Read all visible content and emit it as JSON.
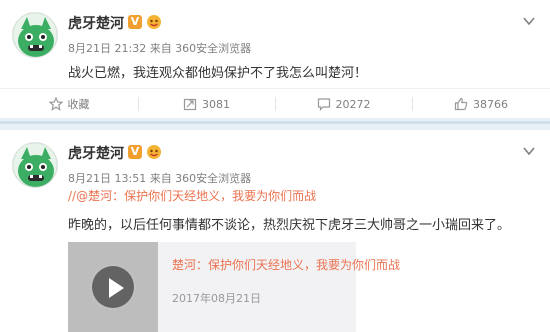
{
  "posts": [
    {
      "author": "虎牙楚河",
      "verified_mark": "V",
      "meta": "8月21日 21:32 来自 360安全浏览器",
      "text": "战火已燃，我连观众都他妈保护不了我怎么叫楚河！",
      "actions": {
        "favorite": "收藏",
        "repost": "3081",
        "comment": "20272",
        "like": "38766"
      }
    },
    {
      "author": "虎牙楚河",
      "verified_mark": "V",
      "meta": "8月21日 13:51 来自 360安全浏览器",
      "repost_line": "//@楚河：保护你们天经地义，我要为你们而战",
      "text": "昨晚的，以后任何事情都不谈论，热烈庆祝下虎牙三大帅哥之一小瑞回来了。",
      "card": {
        "title": "楚河：保护你们天经地义，我要为你们而战",
        "date": "2017年08月21日"
      }
    }
  ],
  "colors": {
    "accent_orange": "#eb7350",
    "verified_gold": "#f1a02f",
    "muted_text": "#808080"
  },
  "icons": [
    "chevron-down-icon",
    "star-outline-icon",
    "repost-icon",
    "comment-icon",
    "thumbs-up-icon",
    "play-icon",
    "emoji-face-icon"
  ]
}
